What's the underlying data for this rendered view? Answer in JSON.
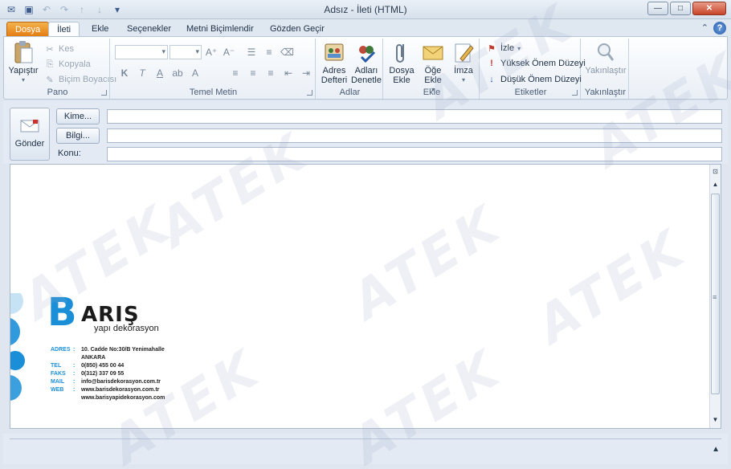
{
  "window": {
    "title": "Adsız - İleti (HTML)"
  },
  "tabs": [
    "Dosya",
    "İleti",
    "Ekle",
    "Seçenekler",
    "Metni Biçimlendir",
    "Gözden Geçir"
  ],
  "ribbon": {
    "pano": {
      "label": "Pano",
      "paste": "Yapıştır",
      "cut": "Kes",
      "copy": "Kopyala",
      "format_painter": "Biçim Boyacısı"
    },
    "temel_metin": {
      "label": "Temel Metin"
    },
    "adlar": {
      "label": "Adlar",
      "address_book": "Adres Defteri",
      "check_names": "Adları Denetle"
    },
    "ekle": {
      "label": "Ekle",
      "attach_file": "Dosya Ekle",
      "attach_item": "Öğe Ekle",
      "signature": "İmza"
    },
    "etiketler": {
      "label": "Etiketler",
      "follow_up": "İzle",
      "high_importance": "Yüksek Önem Düzeyi",
      "low_importance": "Düşük Önem Düzeyi"
    },
    "yakinlastir": {
      "label": "Yakınlaştır",
      "zoom": "Yakınlaştır"
    }
  },
  "header": {
    "send": "Gönder",
    "to_button": "Kime...",
    "cc_button": "Bilgi...",
    "subject_label": "Konu:",
    "to_value": "",
    "cc_value": "",
    "subject_value": ""
  },
  "signature": {
    "logo_b": "B",
    "logo_rest": "ARIŞ",
    "tagline": "yapı dekorasyon",
    "rows": [
      {
        "key": "ADRES",
        "sep": ":",
        "value": "10. Cadde No:30/B Yenimahalle"
      },
      {
        "key": "",
        "sep": "",
        "value": "ANKARA"
      },
      {
        "key": "TEL",
        "sep": ":",
        "value": "0(850) 455 00 44"
      },
      {
        "key": "FAKS",
        "sep": ":",
        "value": "0(312) 337 09 55"
      },
      {
        "key": "MAIL",
        "sep": ":",
        "value": "info@barisdekorasyon.com.tr"
      },
      {
        "key": "WEB",
        "sep": ":",
        "value": "www.barisdekorasyon.com.tr"
      },
      {
        "key": "",
        "sep": "",
        "value": "www.barisyapidekorasyon.com"
      }
    ],
    "colors": {
      "brand_blue": "#1a8fd8"
    }
  },
  "watermark": "ATEK"
}
